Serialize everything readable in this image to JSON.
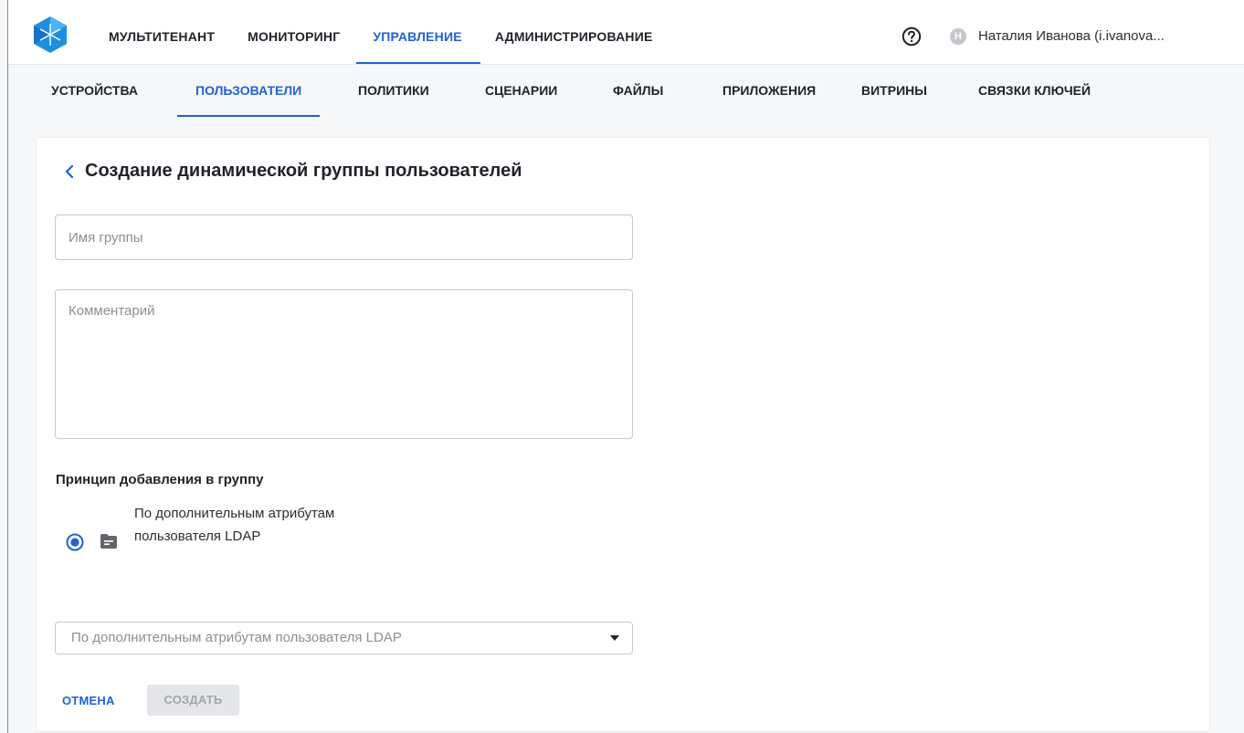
{
  "header": {
    "nav": [
      {
        "label": "МУЛЬТИТЕНАНТ",
        "active": false
      },
      {
        "label": "МОНИТОРИНГ",
        "active": false
      },
      {
        "label": "УПРАВЛЕНИЕ",
        "active": true
      },
      {
        "label": "АДМИНИСТРИРОВАНИЕ",
        "active": false
      }
    ],
    "help_icon": "question-circle-icon",
    "avatar_letter": "Н",
    "user": "Наталия Иванова (i.ivanova..."
  },
  "subnav": [
    {
      "label": "УСТРОЙСТВА",
      "active": false
    },
    {
      "label": "ПОЛЬЗОВАТЕЛИ",
      "active": true
    },
    {
      "label": "ПОЛИТИКИ",
      "active": false
    },
    {
      "label": "СЦЕНАРИИ",
      "active": false
    },
    {
      "label": "ФАЙЛЫ",
      "active": false
    },
    {
      "label": "ПРИЛОЖЕНИЯ",
      "active": false
    },
    {
      "label": "ВИТРИНЫ",
      "active": false
    },
    {
      "label": "СВЯЗКИ КЛЮЧЕЙ",
      "active": false
    }
  ],
  "form": {
    "title": "Создание динамической группы пользователей",
    "name_placeholder": "Имя группы",
    "name_value": "",
    "comment_placeholder": "Комментарий",
    "comment_value": "",
    "principle_label": "Принцип добавления в группу",
    "radio_option": {
      "label": "По дополнительным атрибутам пользователя LDAP",
      "selected": true,
      "icon": "folder-icon"
    },
    "select_value": "По дополнительным атрибутам пользователя LDAP",
    "cancel_label": "ОТМЕНА",
    "create_label": "СОЗДАТЬ",
    "create_enabled": false
  },
  "colors": {
    "accent": "#1f63d3",
    "disabled_bg": "#e4e6e9",
    "disabled_text": "#a2a6ab"
  }
}
